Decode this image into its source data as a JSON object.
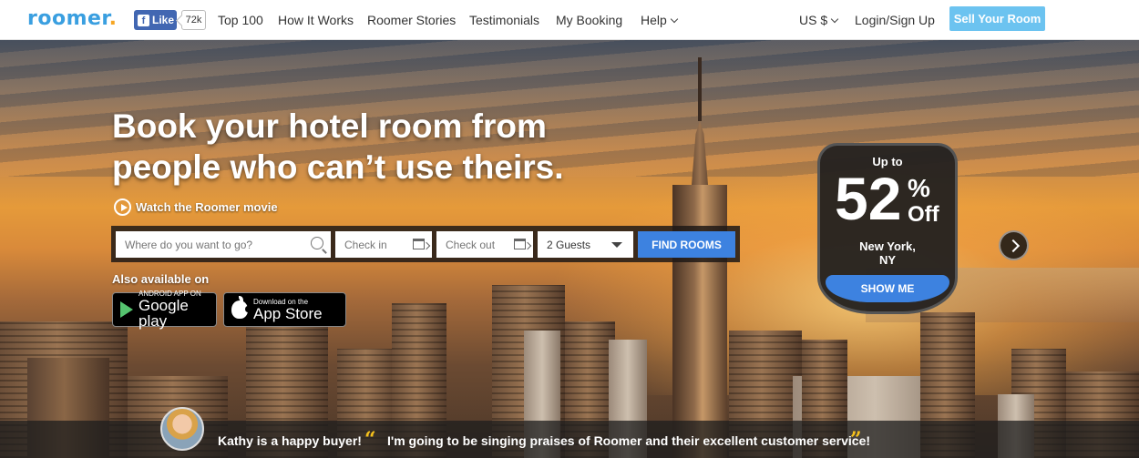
{
  "nav": {
    "logo": "roomer",
    "logo_dot": ".",
    "fb_like": "Like",
    "fb_count": "72k",
    "links": [
      "Top 100",
      "How It Works",
      "Roomer Stories",
      "Testimonials",
      "My Booking",
      "Help"
    ],
    "currency": "US $",
    "login": "Login/Sign Up",
    "sell": "Sell Your Room"
  },
  "hero": {
    "headline_line1": "Book your hotel room from",
    "headline_line2": "people who can’t use theirs.",
    "watch": "Watch the Roomer movie"
  },
  "search": {
    "where_placeholder": "Where do you want to go?",
    "checkin_placeholder": "Check in",
    "checkout_placeholder": "Check out",
    "guests": "2 Guests",
    "find_button": "FIND ROOMS"
  },
  "apps": {
    "also": "Also available on",
    "android_small": "ANDROID APP ON",
    "android_big": "Google play",
    "ios_small": "Download on the",
    "ios_big": "App Store"
  },
  "deal": {
    "upto": "Up to",
    "number": "52",
    "percent": "%",
    "off": "Off",
    "city_line1": "New York,",
    "city_line2": "NY",
    "button": "SHOW ME"
  },
  "testimonial": {
    "who": "Kathy is a happy buyer!",
    "open_quote": "“",
    "quote": "I'm going to be singing praises of Roomer and their excellent customer service!",
    "close_quote": "”"
  },
  "colors": {
    "brand_blue": "#3a9fe0",
    "accent_orange": "#f6a623",
    "button_blue": "#3d82e0",
    "sell_button": "#6cc3f0",
    "quote_yellow": "#f6c21c"
  }
}
